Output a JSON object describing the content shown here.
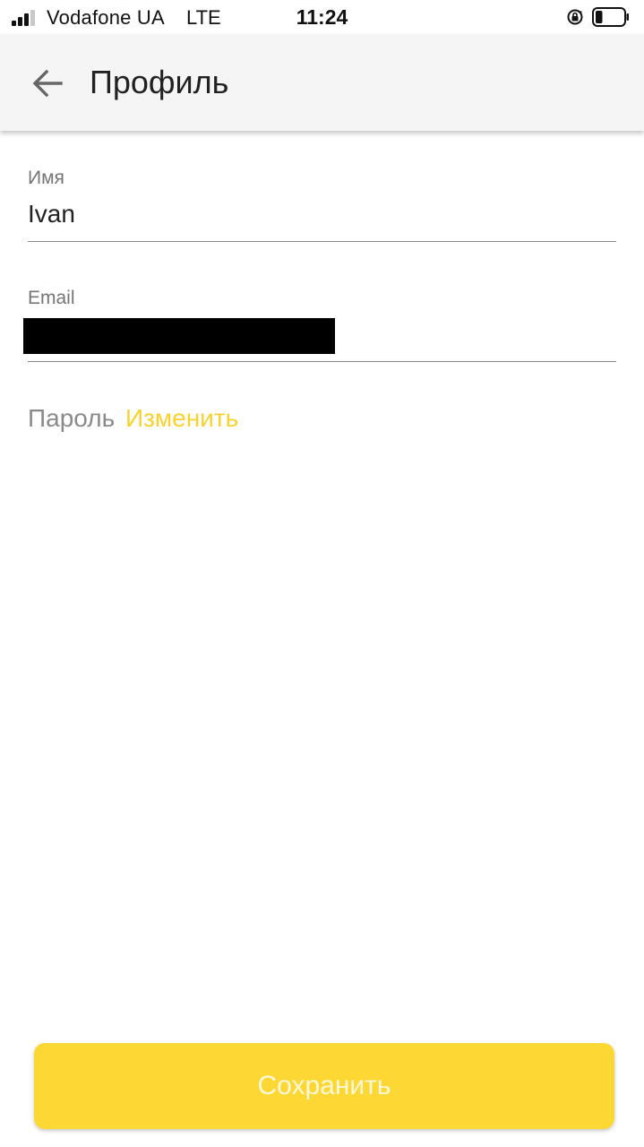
{
  "status_bar": {
    "carrier": "Vodafone UA",
    "network": "LTE",
    "time": "11:24",
    "signal_bars": 3,
    "battery_level": 0.25,
    "icons": [
      "signal-icon",
      "rotation-lock-icon",
      "battery-icon"
    ]
  },
  "header": {
    "title": "Профиль",
    "back_icon": "arrow-left-icon"
  },
  "form": {
    "name_label": "Имя",
    "name_value": "Ivan",
    "email_label": "Email",
    "email_value": "",
    "password_label": "Пароль",
    "password_change": "Изменить"
  },
  "actions": {
    "save_label": "Сохранить"
  },
  "colors": {
    "accent": "#fdd835",
    "link": "#f9d230",
    "app_bar": "#f5f5f5"
  }
}
